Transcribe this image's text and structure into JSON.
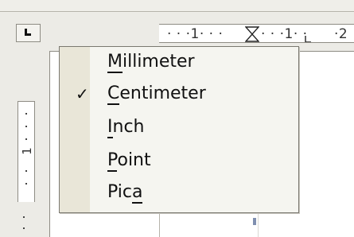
{
  "ruler": {
    "horizontal_text": "· · ·1· · ·",
    "horizontal_text2": "· · ·1· ·",
    "horizontal_text3": "·2",
    "vertical_label": "1"
  },
  "menu": {
    "items": [
      {
        "pre": "",
        "mnemonic": "M",
        "post": "illimeter",
        "checked": false
      },
      {
        "pre": "",
        "mnemonic": "C",
        "post": "entimeter",
        "checked": true
      },
      {
        "pre": "",
        "mnemonic": "I",
        "post": "nch",
        "checked": false
      },
      {
        "pre": "",
        "mnemonic": "P",
        "post": "oint",
        "checked": false
      },
      {
        "pre": "Pic",
        "mnemonic": "a",
        "post": "",
        "checked": false
      }
    ],
    "check_glyph": "✓"
  }
}
